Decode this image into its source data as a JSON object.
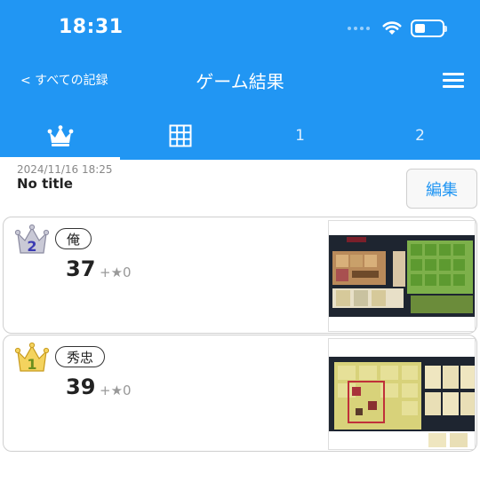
{
  "status": {
    "time": "18:31"
  },
  "nav": {
    "back": "< すべての記録",
    "title": "ゲーム結果"
  },
  "tabs": [
    {
      "icon": "crown-icon",
      "label": ""
    },
    {
      "icon": "grid-icon",
      "label": ""
    },
    {
      "icon": "",
      "label": "1"
    },
    {
      "icon": "",
      "label": "2"
    }
  ],
  "record": {
    "date": "2024/11/16 18:25",
    "title": "No title",
    "edit_label": "編集"
  },
  "results": [
    {
      "rank": "2",
      "player": "俺",
      "score": "37",
      "bonus": "+★0"
    },
    {
      "rank": "1",
      "player": "秀忠",
      "score": "39",
      "bonus": "+★0"
    }
  ],
  "colors": {
    "header": "#2196f3",
    "accent": "#2196f3",
    "silver_crown": "#b9b9c8",
    "gold_crown": "#f2c94c"
  }
}
